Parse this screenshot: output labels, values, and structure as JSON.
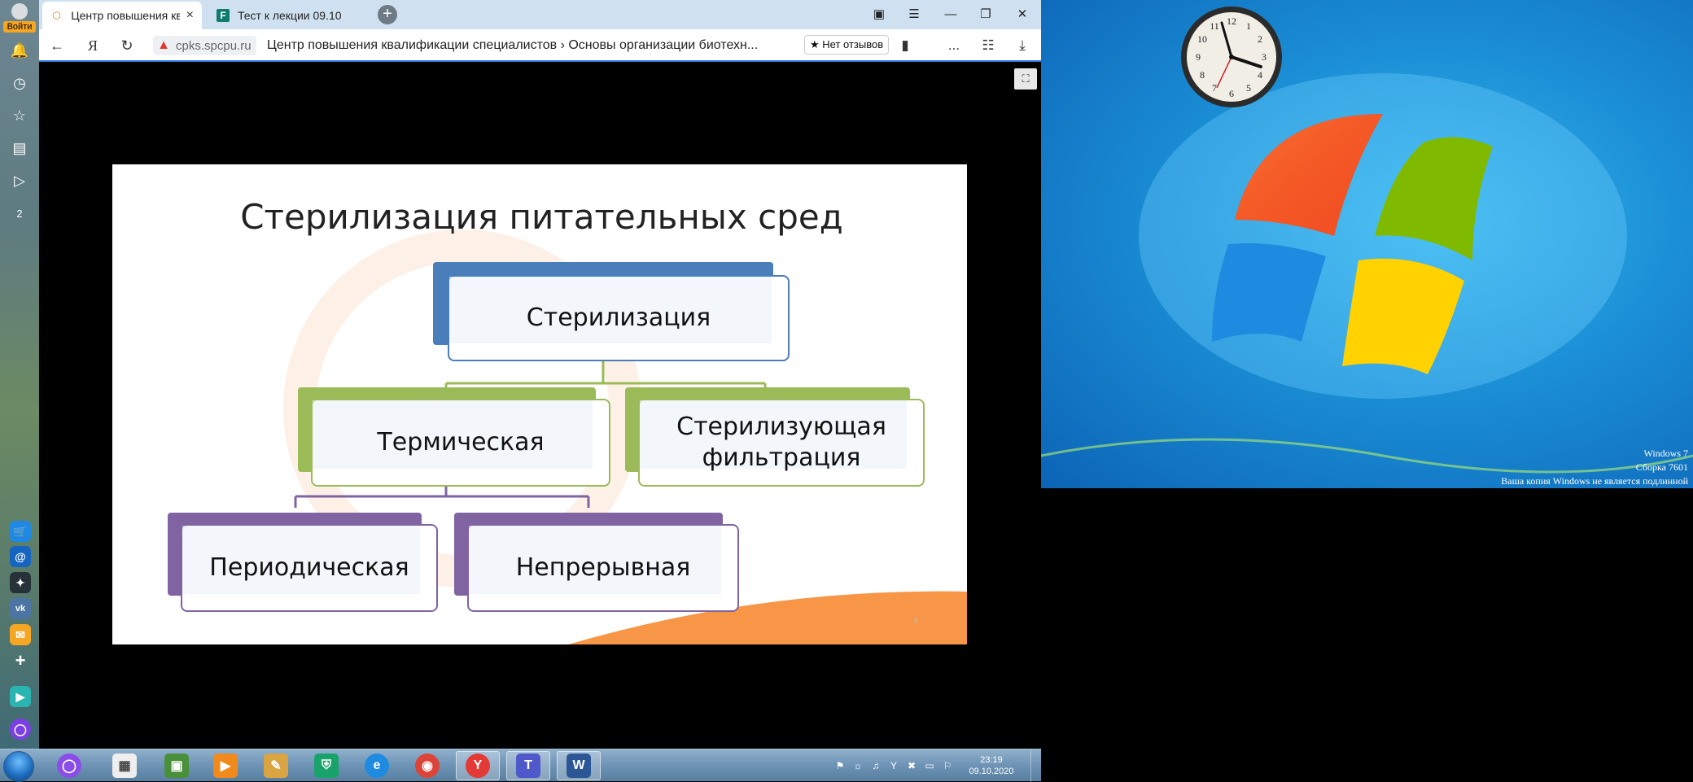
{
  "sidebar": {
    "login_label": "Войти",
    "items": [
      {
        "icon": "bell-icon",
        "glyph": "🔔"
      },
      {
        "icon": "history-icon",
        "glyph": "◷"
      },
      {
        "icon": "star-icon",
        "glyph": "☆"
      },
      {
        "icon": "collections-icon",
        "glyph": "▤"
      },
      {
        "icon": "play-icon",
        "glyph": "▷"
      },
      {
        "icon": "badge-icon",
        "glyph": "2"
      }
    ],
    "apps": [
      {
        "icon": "market-icon",
        "glyph": "🛒",
        "color": "#1e88e5"
      },
      {
        "icon": "mail-at-icon",
        "glyph": "@",
        "color": "#1565c0"
      },
      {
        "icon": "sparkle-icon",
        "glyph": "✦",
        "color": "#263238"
      },
      {
        "icon": "vk-icon",
        "glyph": "vk",
        "color": "#4c75a3"
      },
      {
        "icon": "mail-icon",
        "glyph": "✉",
        "color": "#f5a623"
      },
      {
        "icon": "add-icon",
        "glyph": "+",
        "color": "transparent"
      },
      {
        "icon": "messenger-icon",
        "glyph": "▶",
        "color": "#2bb5b1"
      },
      {
        "icon": "alice-icon",
        "glyph": "◯",
        "color": "#7b3fe4"
      }
    ]
  },
  "tabs": [
    {
      "title": "Центр повышения ква",
      "favicon": "spbu-icon",
      "glyph": "⬡",
      "active": true
    },
    {
      "title": "Тест к лекции 09.10",
      "favicon": "forms-icon",
      "glyph": "F",
      "active": false
    }
  ],
  "window_controls": {
    "pin": "▣",
    "menu": "☰",
    "minimize": "—",
    "restore": "❐",
    "close": "✕"
  },
  "address": {
    "domain": "cpks.spcpu.ru",
    "title": "Центр повышения квалификации специалистов › Основы организации биотехн...",
    "reviews": "★ Нет отзывов",
    "back": "←",
    "ya": "Я",
    "reload": "↻",
    "warn": "▲",
    "bookmark": "▮",
    "more": "...",
    "review_icon": "☷",
    "download": "⤓"
  },
  "player": {
    "fullscreen_glyph": "⛶"
  },
  "slide": {
    "title": "Стерилизация питательных сред",
    "page_number": "6",
    "nodes": {
      "root": "Стерилизация",
      "thermal": "Термическая",
      "filtration": "Стерилизующая фильтрация",
      "periodic": "Периодическая",
      "continuous": "Непрерывная"
    },
    "colors": {
      "blue": "#4a7ebb",
      "green": "#9bbb59",
      "purple": "#8064a2",
      "orange": "#f79646"
    }
  },
  "desktop": {
    "watermark_line1": "Windows 7",
    "watermark_line2": "Сборка 7601",
    "watermark_line3": "Ваша копия Windows не является подлинной"
  },
  "taskbar": {
    "apps": [
      {
        "icon": "yandex-alice-icon",
        "glyph": "◯",
        "color": "#8a4de8",
        "active": false
      },
      {
        "icon": "notepad-icon",
        "glyph": "▦",
        "color": "#eeeeee",
        "active": false
      },
      {
        "icon": "terminal-icon",
        "glyph": "▣",
        "color": "#4a8f3a",
        "active": false
      },
      {
        "icon": "media-player-icon",
        "glyph": "▶",
        "color": "#f08a1d",
        "active": false
      },
      {
        "icon": "paint-icon",
        "glyph": "✎",
        "color": "#d9a441",
        "active": false
      },
      {
        "icon": "shield-icon",
        "glyph": "⛨",
        "color": "#18a36b",
        "active": false
      },
      {
        "icon": "internet-explorer-icon",
        "glyph": "e",
        "color": "#1e8be0",
        "active": false
      },
      {
        "icon": "chrome-icon",
        "glyph": "◉",
        "color": "#db4437",
        "active": false
      },
      {
        "icon": "yandex-browser-icon",
        "glyph": "Y",
        "color": "#e53935",
        "active": true
      },
      {
        "icon": "teams-icon",
        "glyph": "T",
        "color": "#5059c9",
        "active": true
      },
      {
        "icon": "word-icon",
        "glyph": "W",
        "color": "#2b5797",
        "active": true
      }
    ],
    "tray": [
      "⚑",
      "☼",
      "♫",
      "Y",
      "✖",
      "▭",
      "⚐"
    ],
    "time": "23:19",
    "date": "09.10.2020"
  }
}
